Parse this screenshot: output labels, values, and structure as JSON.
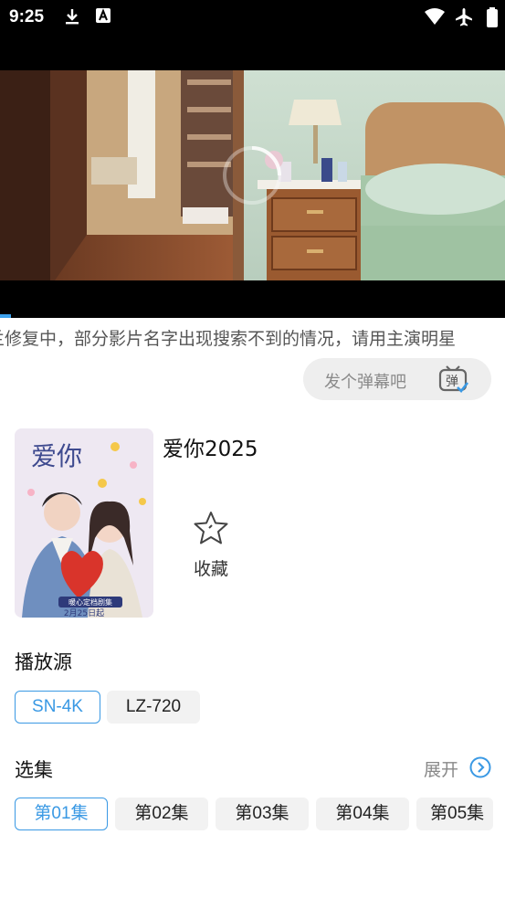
{
  "status_bar": {
    "time": "9:25"
  },
  "notice": "兰修复中，部分影片名字出现搜索不到的情况，请用主演明星",
  "danmu": {
    "label": "发个弹幕吧",
    "icon_char": "弹"
  },
  "movie": {
    "title": "爱你2025",
    "favorite_label": "收藏",
    "poster": {
      "title_text": "爱你",
      "release_text": "2月25日起",
      "badge_text": "暖心定档剧集"
    }
  },
  "sources": {
    "title": "播放源",
    "items": [
      {
        "label": "SN-4K",
        "active": true
      },
      {
        "label": "LZ-720",
        "active": false
      }
    ]
  },
  "episodes": {
    "title": "选集",
    "expand_label": "展开",
    "items": [
      {
        "label": "第01集",
        "active": true
      },
      {
        "label": "第02集",
        "active": false
      },
      {
        "label": "第03集",
        "active": false
      },
      {
        "label": "第04集",
        "active": false
      },
      {
        "label": "第05集",
        "active": false
      }
    ]
  },
  "colors": {
    "accent": "#3a99e4",
    "progress": "#3da2ee"
  }
}
